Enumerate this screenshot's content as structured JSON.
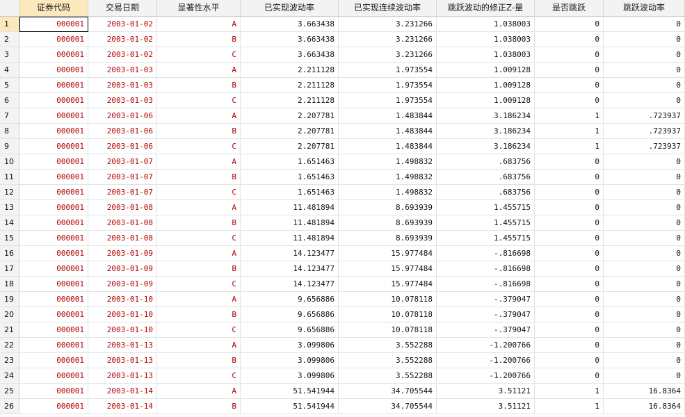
{
  "columns": [
    "证券代码",
    "交易日期",
    "显著性水平",
    "已实现波动率",
    "已实现连续波动率",
    "跳跃波动的修正Z-量",
    "是否跳跃",
    "跳跃波动率"
  ],
  "rows": [
    [
      "1",
      "000001",
      "2003-01-02",
      "A",
      "3.663438",
      "3.231266",
      "1.038003",
      "0",
      "0"
    ],
    [
      "2",
      "000001",
      "2003-01-02",
      "B",
      "3.663438",
      "3.231266",
      "1.038003",
      "0",
      "0"
    ],
    [
      "3",
      "000001",
      "2003-01-02",
      "C",
      "3.663438",
      "3.231266",
      "1.038003",
      "0",
      "0"
    ],
    [
      "4",
      "000001",
      "2003-01-03",
      "A",
      "2.211128",
      "1.973554",
      "1.009128",
      "0",
      "0"
    ],
    [
      "5",
      "000001",
      "2003-01-03",
      "B",
      "2.211128",
      "1.973554",
      "1.009128",
      "0",
      "0"
    ],
    [
      "6",
      "000001",
      "2003-01-03",
      "C",
      "2.211128",
      "1.973554",
      "1.009128",
      "0",
      "0"
    ],
    [
      "7",
      "000001",
      "2003-01-06",
      "A",
      "2.207781",
      "1.483844",
      "3.186234",
      "1",
      ".723937"
    ],
    [
      "8",
      "000001",
      "2003-01-06",
      "B",
      "2.207781",
      "1.483844",
      "3.186234",
      "1",
      ".723937"
    ],
    [
      "9",
      "000001",
      "2003-01-06",
      "C",
      "2.207781",
      "1.483844",
      "3.186234",
      "1",
      ".723937"
    ],
    [
      "10",
      "000001",
      "2003-01-07",
      "A",
      "1.651463",
      "1.498832",
      ".683756",
      "0",
      "0"
    ],
    [
      "11",
      "000001",
      "2003-01-07",
      "B",
      "1.651463",
      "1.498832",
      ".683756",
      "0",
      "0"
    ],
    [
      "12",
      "000001",
      "2003-01-07",
      "C",
      "1.651463",
      "1.498832",
      ".683756",
      "0",
      "0"
    ],
    [
      "13",
      "000001",
      "2003-01-08",
      "A",
      "11.481894",
      "8.693939",
      "1.455715",
      "0",
      "0"
    ],
    [
      "14",
      "000001",
      "2003-01-08",
      "B",
      "11.481894",
      "8.693939",
      "1.455715",
      "0",
      "0"
    ],
    [
      "15",
      "000001",
      "2003-01-08",
      "C",
      "11.481894",
      "8.693939",
      "1.455715",
      "0",
      "0"
    ],
    [
      "16",
      "000001",
      "2003-01-09",
      "A",
      "14.123477",
      "15.977484",
      "-.816698",
      "0",
      "0"
    ],
    [
      "17",
      "000001",
      "2003-01-09",
      "B",
      "14.123477",
      "15.977484",
      "-.816698",
      "0",
      "0"
    ],
    [
      "18",
      "000001",
      "2003-01-09",
      "C",
      "14.123477",
      "15.977484",
      "-.816698",
      "0",
      "0"
    ],
    [
      "19",
      "000001",
      "2003-01-10",
      "A",
      "9.656886",
      "10.078118",
      "-.379047",
      "0",
      "0"
    ],
    [
      "20",
      "000001",
      "2003-01-10",
      "B",
      "9.656886",
      "10.078118",
      "-.379047",
      "0",
      "0"
    ],
    [
      "21",
      "000001",
      "2003-01-10",
      "C",
      "9.656886",
      "10.078118",
      "-.379047",
      "0",
      "0"
    ],
    [
      "22",
      "000001",
      "2003-01-13",
      "A",
      "3.099806",
      "3.552288",
      "-1.200766",
      "0",
      "0"
    ],
    [
      "23",
      "000001",
      "2003-01-13",
      "B",
      "3.099806",
      "3.552288",
      "-1.200766",
      "0",
      "0"
    ],
    [
      "24",
      "000001",
      "2003-01-13",
      "C",
      "3.099806",
      "3.552288",
      "-1.200766",
      "0",
      "0"
    ],
    [
      "25",
      "000001",
      "2003-01-14",
      "A",
      "51.541944",
      "34.705544",
      "3.51121",
      "1",
      "16.8364"
    ],
    [
      "26",
      "000001",
      "2003-01-14",
      "B",
      "51.541944",
      "34.705544",
      "3.51121",
      "1",
      "16.8364"
    ]
  ],
  "selected_column_index": 0,
  "selected_row_index": 0,
  "colors": {
    "string_text": "#b30000",
    "number_text": "#111111",
    "header_bg": "#f3f3f3",
    "selected_header_bg": "#fbe8bd"
  }
}
